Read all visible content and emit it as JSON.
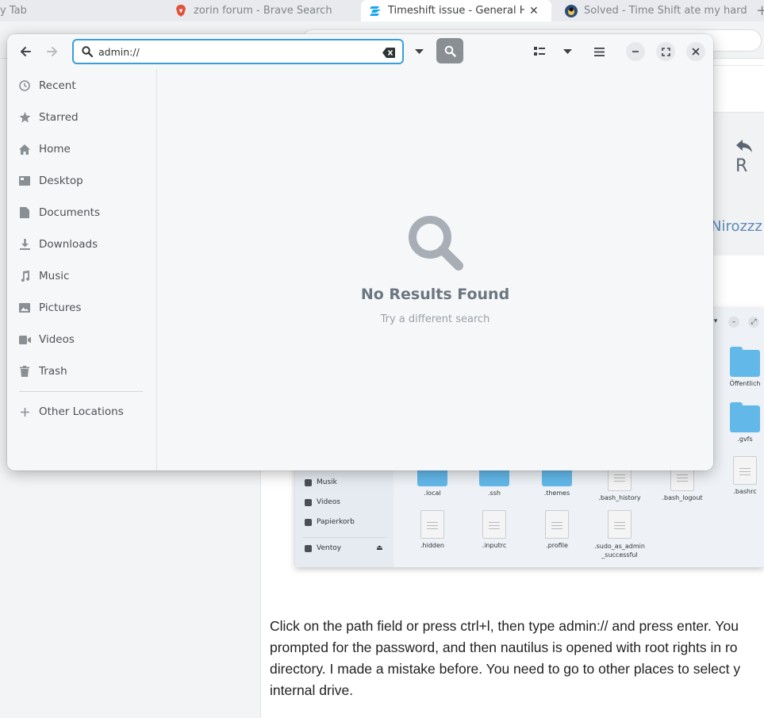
{
  "browser": {
    "tabs": [
      {
        "label": "New Tab",
        "shown": "y Tab",
        "active": false
      },
      {
        "label": "zorin forum - Brave Search",
        "active": false
      },
      {
        "label": "Timeshift issue - General He",
        "active": true
      },
      {
        "label": "Solved - Time Shift ate my hard",
        "active": false
      }
    ],
    "new_tab": "+"
  },
  "forum": {
    "reply_label": "R",
    "author": "Nirozzz",
    "post_lines": [
      "Click on the path field or press ctrl+l, then type admin:// and press enter. You",
      "prompted for the password, and then nautilus is opened with root rights in ro",
      "directory. I made a mistake before. You need to go to other places to select y",
      "internal drive."
    ],
    "screenshot": {
      "sidebar": [
        "Musik",
        "Videos",
        "Papierkorb",
        "Ventoy"
      ],
      "files": [
        {
          "name": ".local"
        },
        {
          "name": ".ssh"
        },
        {
          "name": ".themes"
        },
        {
          "name": ".bash_history"
        },
        {
          "name": ".bash_logout"
        },
        {
          "name": ".bashrc"
        },
        {
          "name": ".hidden"
        },
        {
          "name": ".inputrc"
        },
        {
          "name": ".profile"
        },
        {
          "name": ".sudo_as_admin\n_successful"
        },
        {
          "name": "Öffentlich"
        },
        {
          "name": ".gvfs"
        }
      ]
    }
  },
  "dialog": {
    "search": {
      "value": "admin://"
    },
    "sidebar": [
      {
        "label": "Recent",
        "icon": "clock-icon"
      },
      {
        "label": "Starred",
        "icon": "star-icon"
      },
      {
        "label": "Home",
        "icon": "home-icon"
      },
      {
        "label": "Desktop",
        "icon": "desktop-icon"
      },
      {
        "label": "Documents",
        "icon": "document-icon"
      },
      {
        "label": "Downloads",
        "icon": "download-icon"
      },
      {
        "label": "Music",
        "icon": "music-icon"
      },
      {
        "label": "Pictures",
        "icon": "picture-icon"
      },
      {
        "label": "Videos",
        "icon": "video-icon"
      },
      {
        "label": "Trash",
        "icon": "trash-icon"
      }
    ],
    "other_locations": "Other Locations",
    "empty_state": {
      "title": "No Results Found",
      "subtitle": "Try a different search"
    }
  },
  "colors": {
    "accent": "#3a9fd8",
    "folder": "#63b8ea",
    "author": "#5d89b8"
  }
}
